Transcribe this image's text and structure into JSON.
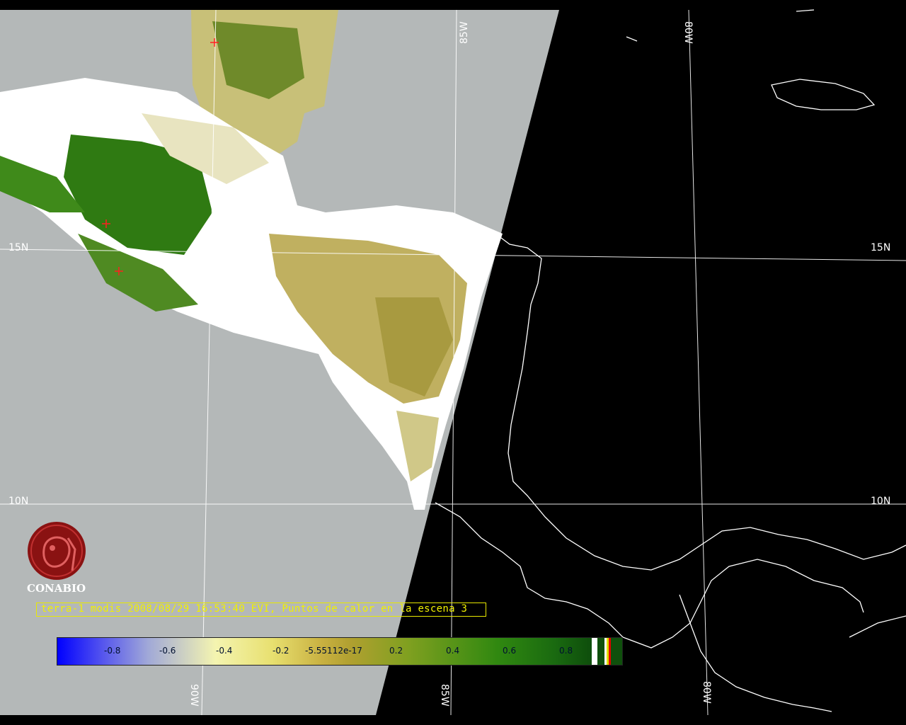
{
  "map": {
    "grid_labels": {
      "lon_top_85": "85W",
      "lon_top_80": "80W",
      "lat_left_15": "15N",
      "lat_right_15": "15N",
      "lat_left_10": "10N",
      "lat_right_10": "10N",
      "lon_bottom_90": "90W",
      "lon_bottom_85": "85W",
      "lon_bottom_80": "80W"
    },
    "colors": {
      "no_data_area": "#b4b8b8",
      "night_area": "#000000",
      "cloud": "#ffffff",
      "vegetation_dense": "#2f7a12",
      "vegetation_sparse": "#c8c078",
      "grid": "#ffffff",
      "hotspot": "#ff2020"
    }
  },
  "logo": {
    "name": "CONABIO",
    "icon": "conabio-logo-icon"
  },
  "caption": {
    "text": "terra-1 modis 2008/08/29 16:53:40 EVI, Puntos de calor en la escena 3"
  },
  "colorbar": {
    "labels": [
      "-0.8",
      "-0.6",
      "-0.4",
      "-0.2",
      "-5.55112e-17",
      "0.2",
      "0.4",
      "0.6",
      "0.8"
    ]
  }
}
